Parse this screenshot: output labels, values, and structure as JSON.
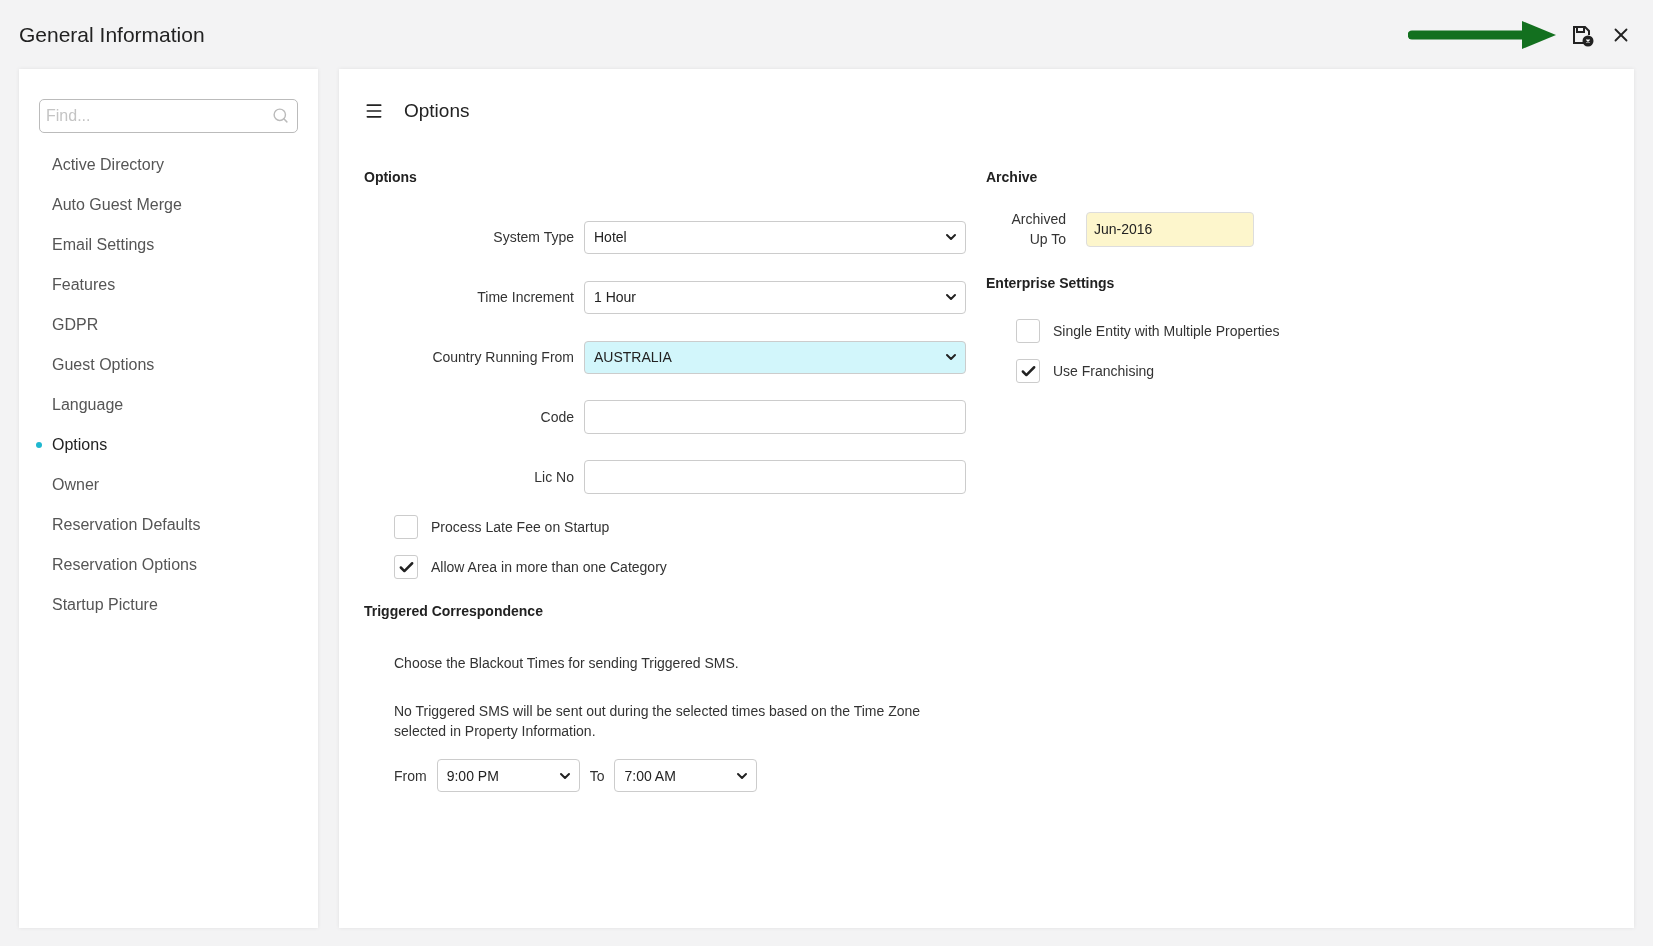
{
  "header": {
    "title": "General Information"
  },
  "sidebar": {
    "search_placeholder": "Find...",
    "items": [
      {
        "label": "Active Directory",
        "selected": false
      },
      {
        "label": "Auto Guest Merge",
        "selected": false
      },
      {
        "label": "Email Settings",
        "selected": false
      },
      {
        "label": "Features",
        "selected": false
      },
      {
        "label": "GDPR",
        "selected": false
      },
      {
        "label": "Guest Options",
        "selected": false
      },
      {
        "label": "Language",
        "selected": false
      },
      {
        "label": "Options",
        "selected": true
      },
      {
        "label": "Owner",
        "selected": false
      },
      {
        "label": "Reservation Defaults",
        "selected": false
      },
      {
        "label": "Reservation Options",
        "selected": false
      },
      {
        "label": "Startup Picture",
        "selected": false
      }
    ]
  },
  "main": {
    "title": "Options",
    "options": {
      "heading": "Options",
      "fields": [
        {
          "kind": "select",
          "label": "System Type",
          "value": "Hotel",
          "highlighted": false
        },
        {
          "kind": "select",
          "label": "Time Increment",
          "value": "1 Hour",
          "highlighted": false
        },
        {
          "kind": "select",
          "label": "Country Running From",
          "value": "AUSTRALIA",
          "highlighted": true
        },
        {
          "kind": "text",
          "label": "Code",
          "highlighted": false
        },
        {
          "kind": "text",
          "label": "Lic No",
          "highlighted": false
        }
      ],
      "checkboxes": [
        {
          "label": "Process Late Fee on Startup",
          "checked": false
        },
        {
          "label": "Allow Area in more than one Category",
          "checked": true
        }
      ]
    },
    "triggered": {
      "heading": "Triggered Correspondence",
      "paragraphs": [
        "Choose the Blackout Times for sending Triggered SMS.",
        "No Triggered SMS will be sent out during the selected times based on the Time Zone selected in Property Information."
      ],
      "from_label": "From",
      "from_value": "9:00 PM",
      "to_label": "To",
      "to_value": "7:00 AM"
    },
    "archive": {
      "heading": "Archive",
      "label": "Archived Up To",
      "value": "Jun-2016"
    },
    "enterprise": {
      "heading": "Enterprise Settings",
      "checkboxes": [
        {
          "label": "Single Entity with Multiple Properties",
          "checked": false
        },
        {
          "label": "Use Franchising",
          "checked": true
        }
      ]
    }
  }
}
